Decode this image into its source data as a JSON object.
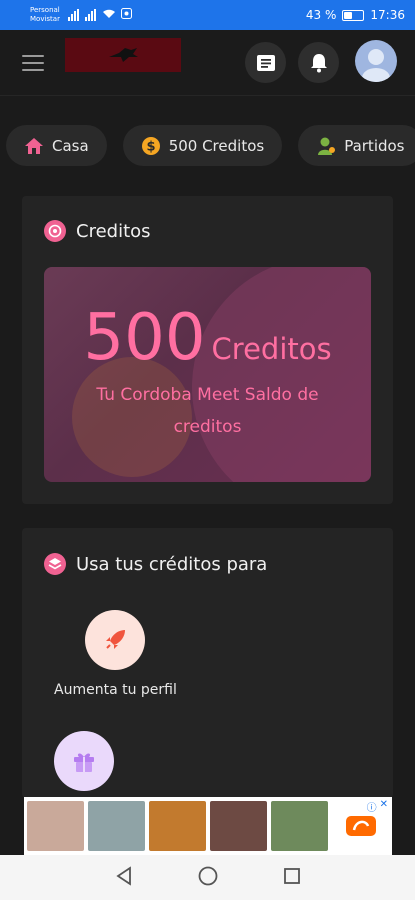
{
  "status_bar": {
    "carrier_line1": "Personal",
    "carrier_line2": "Movistar",
    "battery": "43 %",
    "time": "17:36"
  },
  "header": {
    "menu_icon": "hamburger-icon",
    "logo": "app-logo",
    "messages_icon": "message-icon",
    "notifications_icon": "bell-icon",
    "avatar": "user-avatar"
  },
  "chips": [
    {
      "label": "Casa",
      "icon": "home-icon",
      "color": "#f06292"
    },
    {
      "label": "500 Creditos",
      "icon": "coin-icon",
      "color": "#f5a623"
    },
    {
      "label": "Partidos",
      "icon": "people-icon",
      "color": "#7cb342"
    }
  ],
  "credits_card": {
    "title": "Creditos",
    "amount": "500",
    "unit": "Creditos",
    "subtitle": "Tu Cordoba Meet Saldo de creditos"
  },
  "use_card": {
    "title": "Usa tus créditos para",
    "items": [
      {
        "label": "Aumenta tu perfil",
        "icon": "rocket-icon"
      },
      {
        "label": "",
        "icon": "gift-icon"
      }
    ]
  },
  "colors": {
    "accent": "#f06292",
    "credit_text": "#ff6fa1",
    "status_bar": "#1e74ea",
    "background": "#1b1b1b",
    "card": "#242424"
  }
}
